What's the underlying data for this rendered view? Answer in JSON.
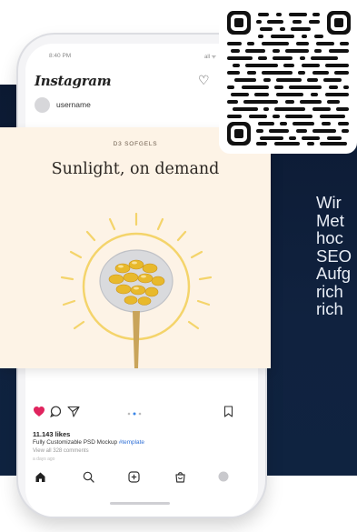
{
  "side_text": "Wir\nMet\nhoc\nSEO\nAufg\nrich\nrich",
  "phone": {
    "status_time": "8:40 PM",
    "status_right": "all ᯤ",
    "app_name": "Instagram",
    "username": "username",
    "post": {
      "brand": "D3 SOFGELS",
      "headline": "Sunlight, on demand"
    },
    "likes": "11.143 likes",
    "caption": "Fully Customizable PSD Mockup",
    "caption_tag": "#template",
    "comments": "View all 328 comments",
    "time_ago": "a days ago"
  },
  "colors": {
    "navy": "#0c1a33",
    "post_bg": "#fdf3e6",
    "sun": "#f4d46b",
    "heart": "#e0245e"
  },
  "icons": {
    "heart": "heart-icon",
    "comment": "comment-icon",
    "share": "send-icon",
    "bookmark": "bookmark-icon",
    "home": "home-icon",
    "search": "search-icon",
    "add": "add-post-icon",
    "shop": "shop-icon",
    "profile": "profile-icon"
  }
}
